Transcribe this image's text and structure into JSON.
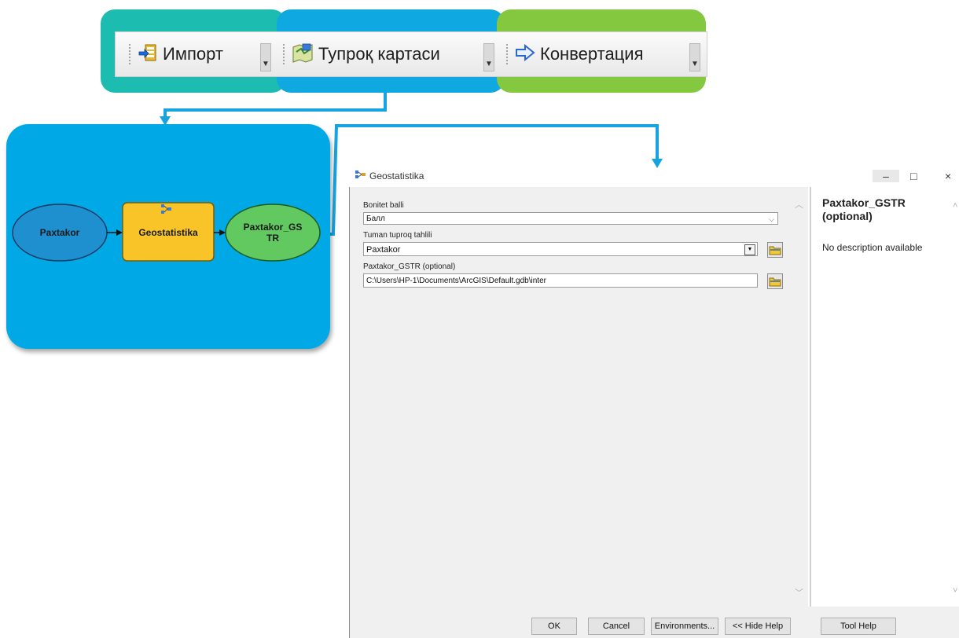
{
  "toolbar": {
    "import_label": "Импорт",
    "soilmap_label": "Тупроқ картаси",
    "convert_label": "Конвертация"
  },
  "model": {
    "input_node": "Paxtakor",
    "tool_node": "Geostatistika",
    "output_node_line1": "Paxtakor_GS",
    "output_node_line2": "TR"
  },
  "dialog": {
    "title": "Geostatistika",
    "window_controls": {
      "minimize": "–",
      "maximize": "□",
      "close": "×"
    },
    "params": [
      {
        "label": "Bonitet balli",
        "value": "Балл"
      },
      {
        "label": "Tuman tuproq tahlili",
        "value": "Paxtakor"
      },
      {
        "label": "Paxtakor_GSTR (optional)",
        "value": "C:\\Users\\HP-1\\Documents\\ArcGIS\\Default.gdb\\inter"
      }
    ],
    "help": {
      "heading": "Paxtakor_GSTR (optional)",
      "text": "No description available"
    },
    "buttons": {
      "ok": "OK",
      "cancel": "Cancel",
      "environments": "Environments...",
      "hide_help": "<< Hide Help",
      "tool_help": "Tool Help"
    }
  },
  "colors": {
    "teal": "#1cbcb0",
    "blue": "#10a8e0",
    "green": "#84c840",
    "model_bg": "#00a8e6",
    "input_node": "#1e90d0",
    "tool_node": "#f8c428",
    "output_node": "#62c860"
  },
  "icons": [
    "import-icon",
    "map-icon",
    "arrow-right-icon",
    "folder-icon",
    "model-tool-icon"
  ]
}
